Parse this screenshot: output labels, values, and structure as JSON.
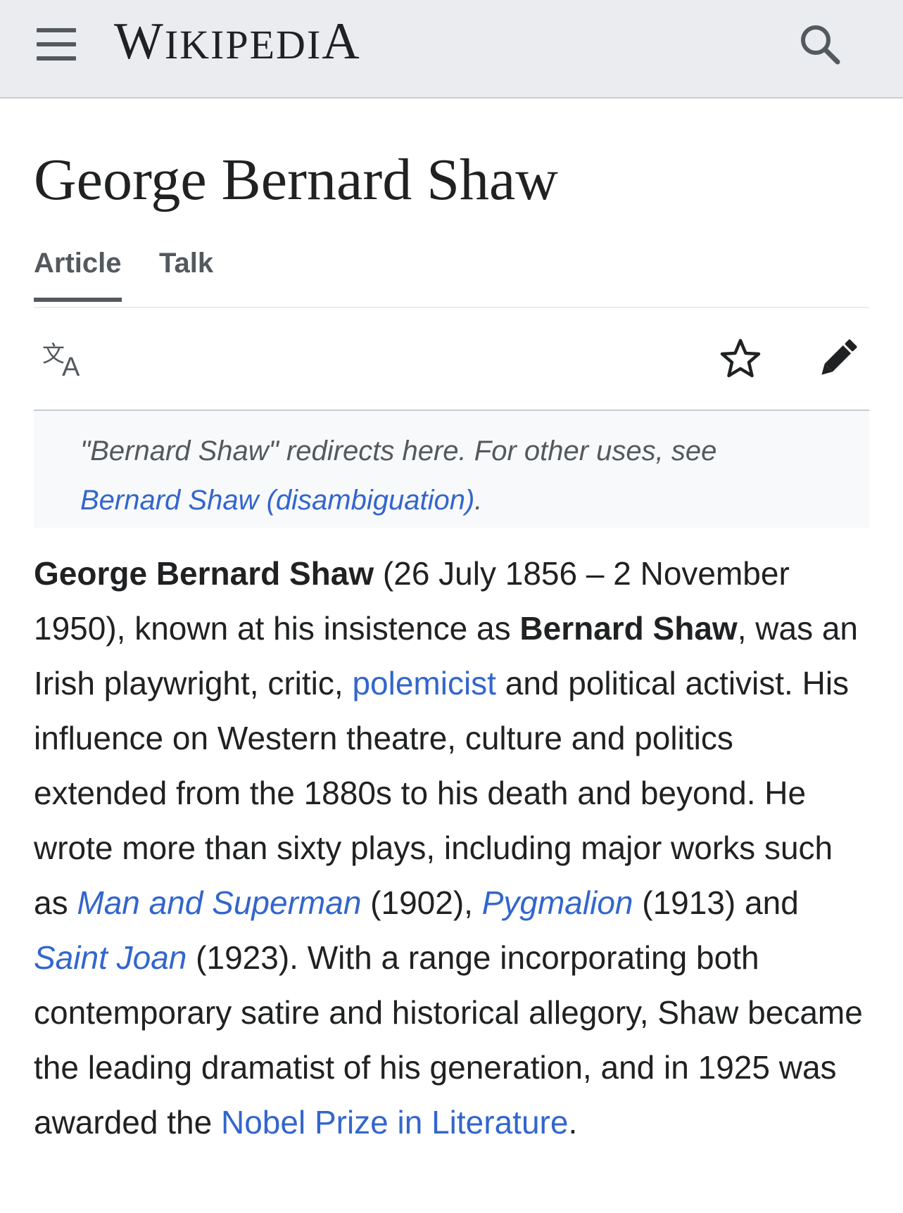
{
  "header": {
    "logo_initial": "W",
    "logo_rest": "IKIPEDI",
    "logo_final": "A",
    "menu_icon": "hamburger-menu-icon",
    "search_icon": "search-icon"
  },
  "page": {
    "title": "George Bernard Shaw"
  },
  "tabs": [
    {
      "label": "Article",
      "active": true
    },
    {
      "label": "Talk",
      "active": false
    }
  ],
  "actions": {
    "language_icon": "language-icon",
    "watch_icon": "star-icon",
    "edit_icon": "pencil-icon"
  },
  "hatnote": {
    "text": "\"Bernard Shaw\" redirects here. For other uses, see",
    "link": "Bernard Shaw (disambiguation)",
    "end": "."
  },
  "lead": {
    "subject": "George Bernard Shaw",
    "t1": " (26 July 1856 – 2 November 1950), known at his insistence as ",
    "alias": "Bernard Shaw",
    "t2": ", was an Irish playwright, critic, ",
    "link_polemicist": "polemicist",
    "t3": " and political activist. His influence on Western theatre, culture and politics extended from the 1880s to his death and beyond. He wrote more than sixty plays, including major works such as ",
    "link_man_superman": "Man and Superman",
    "t4": " (1902), ",
    "link_pygmalion": "Pygmalion",
    "t5": " (1913) and ",
    "link_saint_joan": "Saint Joan",
    "t6": " (1923). With a range incorporating both contemporary satire and historical allegory, Shaw became the leading dramatist of his generation, and in 1925 was awarded the ",
    "link_nobel": "Nobel Prize in Literature",
    "t7": "."
  },
  "colors": {
    "link": "#3366cc",
    "text": "#202122",
    "header_bg": "#eaecf0",
    "icon": "#54595d"
  }
}
